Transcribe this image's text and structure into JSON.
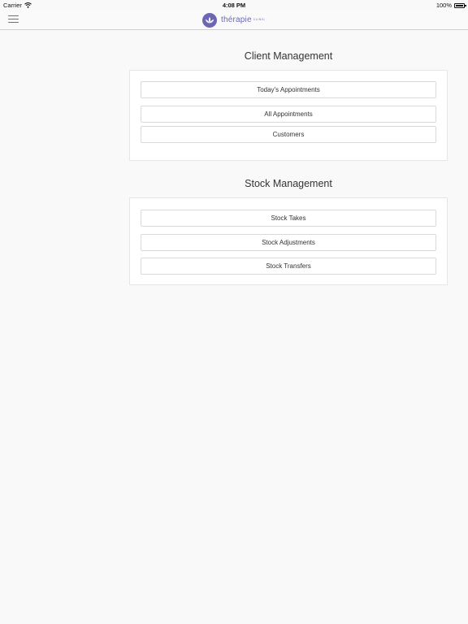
{
  "status_bar": {
    "carrier": "Carrier",
    "time": "4:08 PM",
    "battery": "100%"
  },
  "nav": {
    "menu_icon": "hamburger-menu-icon",
    "logo_text": "thérapie",
    "logo_sub": "CLINIC",
    "brand_color": "#6b67b3"
  },
  "client_management": {
    "title": "Client Management",
    "buttons": [
      "Today's Appointments",
      "All Appointments",
      "Customers"
    ]
  },
  "stock_management": {
    "title": "Stock Management",
    "buttons": [
      "Stock Takes",
      "Stock Adjustments",
      "Stock Transfers"
    ]
  }
}
